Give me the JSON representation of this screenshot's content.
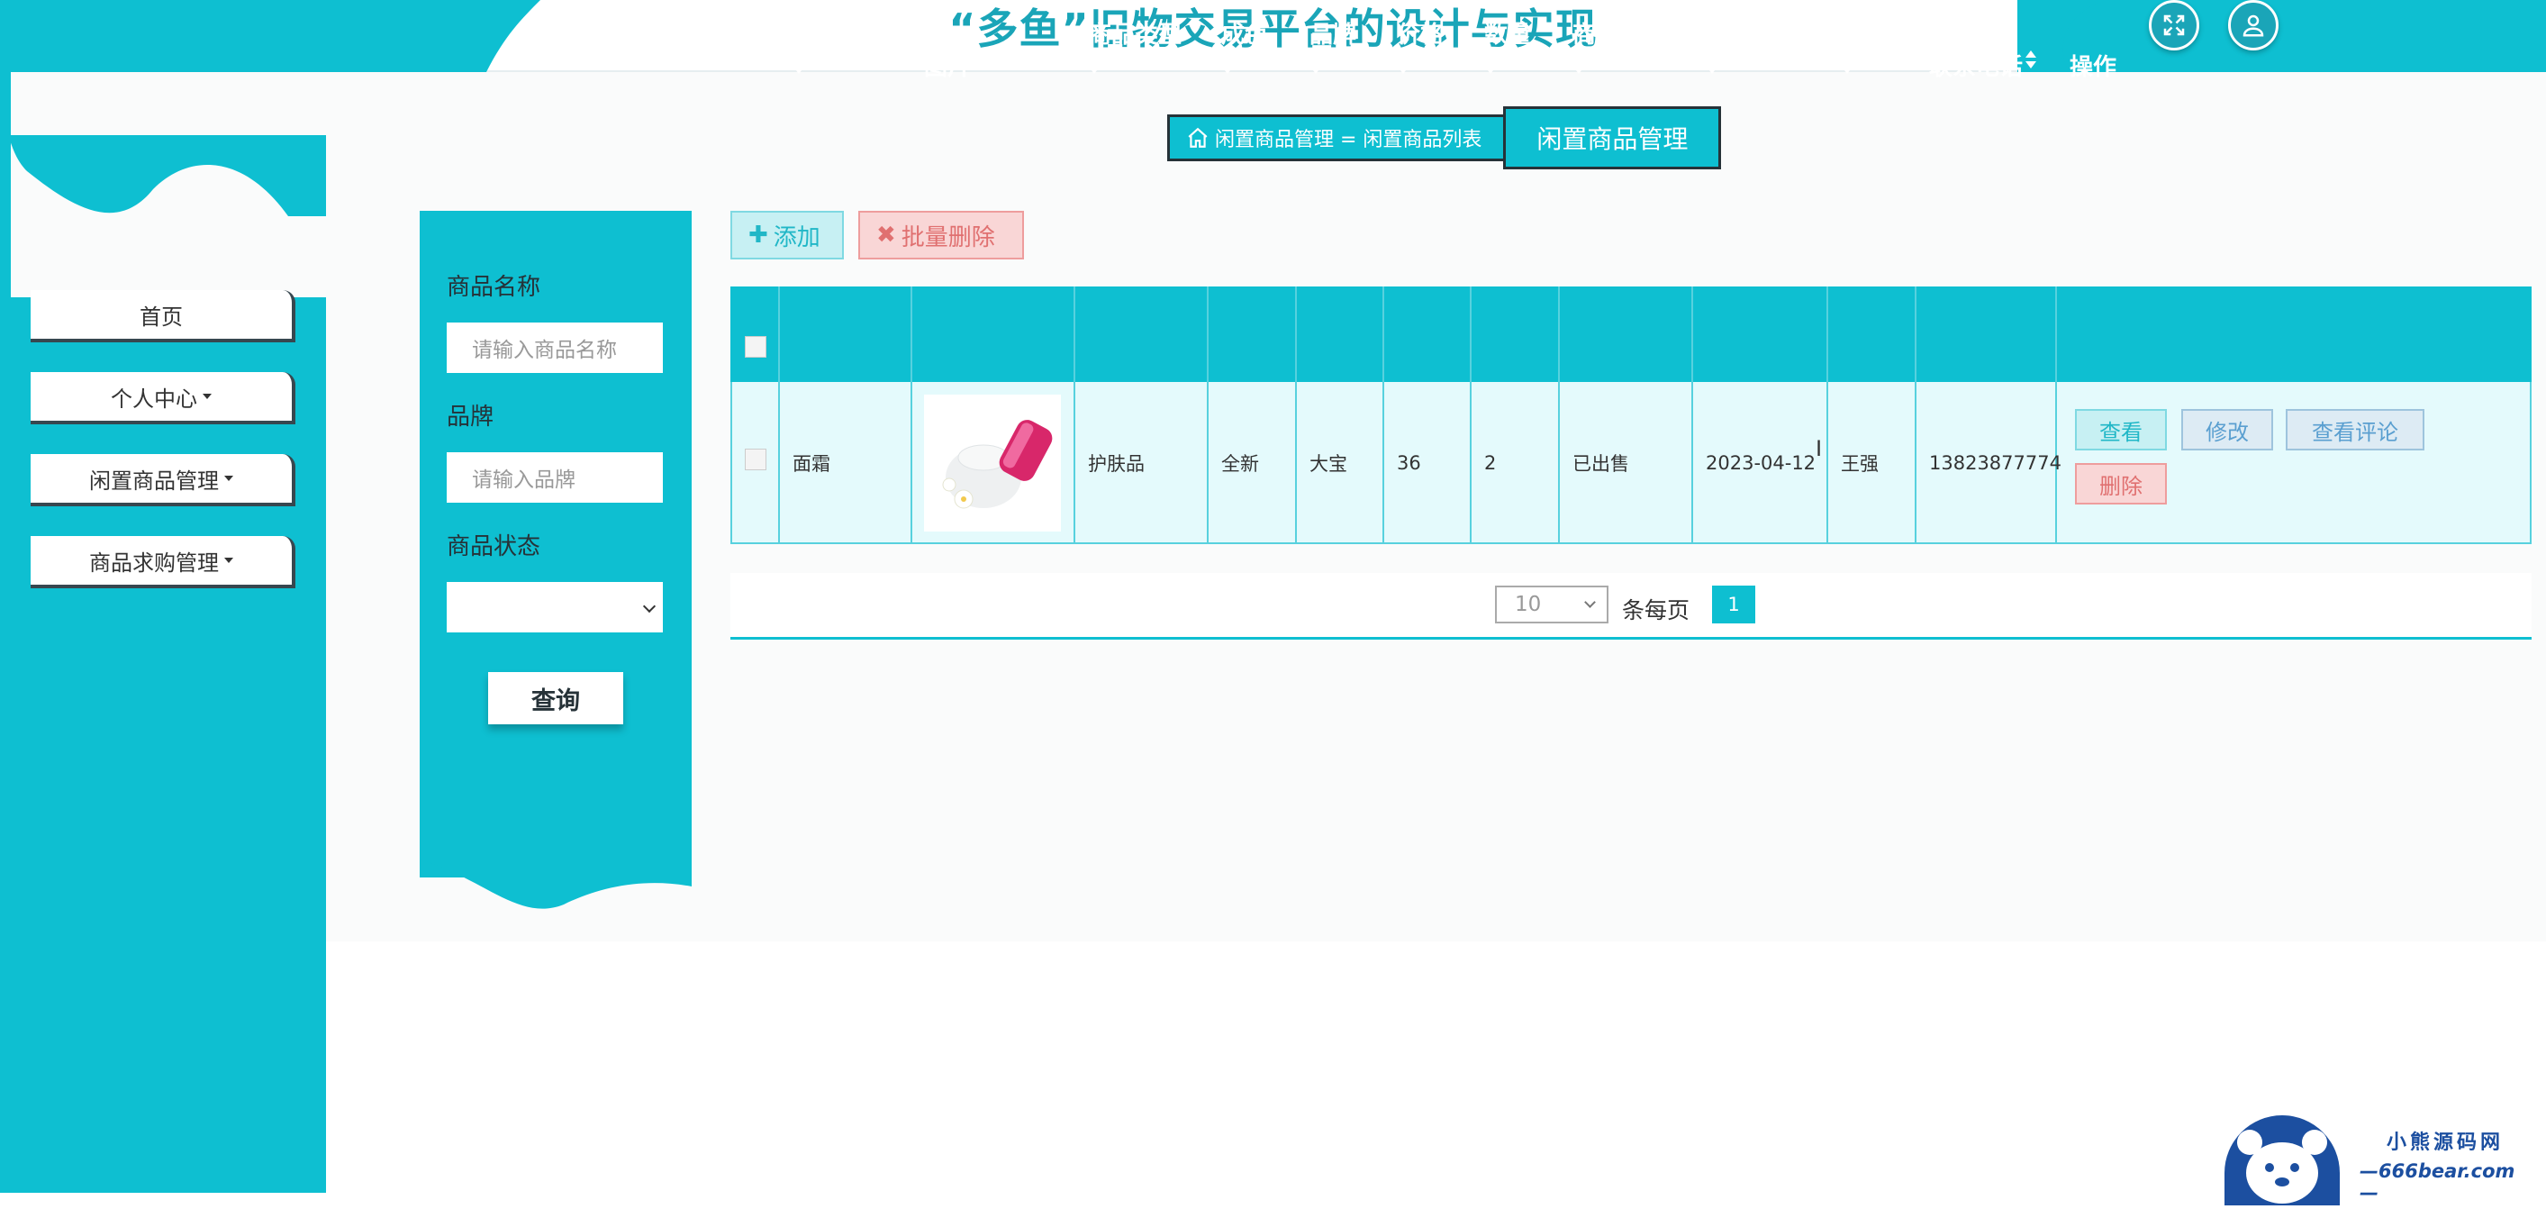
{
  "header": {
    "title": "“多鱼”旧物交易平台的设计与实现",
    "fullscreen_icon": "fullscreen-icon",
    "user_icon": "user-icon"
  },
  "sidebar": {
    "items": [
      {
        "label": "首页",
        "has_caret": false
      },
      {
        "label": "个人中心",
        "has_caret": true
      },
      {
        "label": "闲置商品管理",
        "has_caret": true
      },
      {
        "label": "商品求购管理",
        "has_caret": true
      }
    ]
  },
  "breadcrumb": {
    "home_icon": "home-icon",
    "path": "闲置商品管理 = 闲置商品列表",
    "active": "闲置商品管理"
  },
  "search": {
    "name_label": "商品名称",
    "name_placeholder": "请输入商品名称",
    "brand_label": "品牌",
    "brand_placeholder": "请输入品牌",
    "status_label": "商品状态",
    "status_value": "",
    "query_label": "查询"
  },
  "toolbar": {
    "add_label": "添加",
    "batch_delete_label": "批量删除"
  },
  "table": {
    "columns": [
      "商品名称",
      "图片",
      "商品类型",
      "成色",
      "品牌",
      "价格",
      "数量",
      "商品状态",
      "发布日期",
      "卖家",
      "联系电话",
      "操作"
    ],
    "rows": [
      {
        "name": "面霜",
        "type": "护肤品",
        "condition": "全新",
        "brand": "大宝",
        "price": "36",
        "quantity": "2",
        "status": "已出售",
        "date": "2023-04-12",
        "seller": "王强",
        "phone": "13823877774",
        "actions": [
          "查看",
          "修改",
          "查看评论",
          "删除"
        ]
      }
    ]
  },
  "pagination": {
    "page_size": "10",
    "per_page_label": "条每页",
    "current_page": "1"
  },
  "watermark": {
    "line1": "小熊源码网",
    "line2": "—666bear.com—"
  },
  "colors": {
    "accent": "#0ebfd1",
    "title": "#1aa5b8",
    "danger": "#e07070"
  }
}
